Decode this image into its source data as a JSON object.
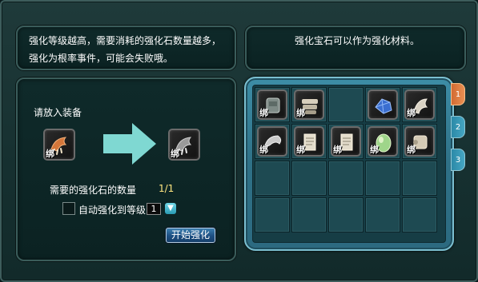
{
  "strengthen": {
    "desc_left": "强化等级越高，需要消耗的强化石数量越多，强化为根率事件，可能会失败哦。",
    "desc_right": "强化宝石可以作为强化材料。",
    "place_equipment_label": "请放入装备",
    "bind_label": "绑",
    "stones_needed_label": "需要的强化石的数量",
    "stones_needed_count": "1/1",
    "auto_strengthen_label": "自动强化到等级",
    "target_level": "1",
    "start_button": "开始强化"
  },
  "inventory": {
    "tabs": [
      "1",
      "2",
      "3"
    ],
    "active_tab": "1",
    "rows": [
      [
        {
          "icon": "gray-armor-icon",
          "bound": true
        },
        {
          "icon": "scroll-stack-icon",
          "bound": true
        },
        {
          "icon": "empty",
          "bound": false
        },
        {
          "icon": "blue-gem-icon",
          "bound": false
        },
        {
          "icon": "white-claw-icon",
          "bound": true
        }
      ],
      [
        {
          "icon": "silver-horn-icon",
          "bound": true
        },
        {
          "icon": "paper-scroll-icon",
          "bound": true
        },
        {
          "icon": "paper-scroll-icon",
          "bound": true
        },
        {
          "icon": "green-egg-icon",
          "bound": true
        },
        {
          "icon": "rolled-scroll-icon",
          "bound": true
        }
      ]
    ]
  },
  "colors": {
    "accent_arrow": "#7fd8d2",
    "tab_active": "#d9743a",
    "tab_inactive": "#3a9bbb"
  }
}
